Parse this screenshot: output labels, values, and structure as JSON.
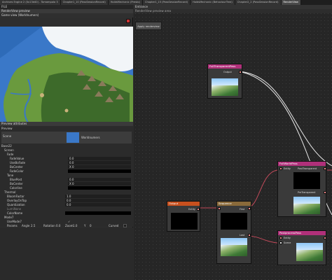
{
  "tabs": [
    {
      "label": "Archives Engine 2 (0x13d40) - Tomampola 3"
    },
    {
      "label": "Chapter1_10 (PassSessionRecord)"
    },
    {
      "label": "HoldsMechanic (Presto)"
    },
    {
      "label": "Chapter1_15 (PassSessionRecord)"
    },
    {
      "label": "HoldsMechanic (BehaviourTree)"
    },
    {
      "label": "Chapter2_2 (PassSessionRecord)"
    },
    {
      "label": "RenderView"
    }
  ],
  "menu": {
    "file": "FILE"
  },
  "left": {
    "preview_header": "RenderView preview",
    "preview_subheader": "Game view (Worldnumers)",
    "attr_header": "Preview attributes",
    "preview_section": "Preview",
    "scene_label": "Scene",
    "scene_value": "Worldnumers",
    "group_label": "Base22",
    "screen_label": "Screen",
    "fade_label": "Fade",
    "fade_value_label": "FadeValue",
    "fade_value": "0.0",
    "use_fade_label": "UseBoFade",
    "use_fade_value": "0.0",
    "bo_center_label": "BoCenter",
    "bo_center_value": "X   0",
    "fade_color_label": "FadeColor",
    "tone_label": "Tone",
    "blur_label": "BluePost",
    "blur_value": "0.0",
    "tone_center_label": "BoCenter",
    "tone_center_value": "X   0",
    "tone_color_label": "Colorline",
    "thermal_label": "Thermal",
    "bloom_label": "BloomFactor",
    "bloom_value": "1.0",
    "overlay_label": "OverlayOnTop",
    "overlay_value": "0.0",
    "quant_label": "Quantization",
    "quant_value": "0.0",
    "luminance_label": "LumiNone",
    "colorname_label": "ColorName",
    "mode_label": "Mode7",
    "usemode_label": "UseMode7",
    "params_label": "Params",
    "angle_label": "Angle",
    "angle_value": "2.5",
    "rotation_label": "Rotation",
    "rotation_value": "0.0",
    "zoom_label": "Zoom",
    "zoom_value": "1.0",
    "y_label": "Y",
    "y_value": "0",
    "curved_label": "Curved"
  },
  "right": {
    "header": "Entrance",
    "subheader": "RenderView preview area",
    "apply_button": "Apply renderview",
    "nodes": {
      "full_transparent": {
        "title": "FullTransparentPass",
        "port_out": "Output"
      },
      "full_world": {
        "title": "FullWorldPass",
        "port_entity": "Entity",
        "port_post": "PostTransparent",
        "port_pre": "PreTransparent"
      },
      "output": {
        "title": "Output",
        "port_entity": "Entity"
      },
      "sequence": {
        "title": "Sequence",
        "port_first": "First",
        "port_last": "Last"
      },
      "postprocess": {
        "title": "PostprocessPass",
        "port_entity": "Entity",
        "port_scene": "Scene"
      }
    }
  },
  "colors": {
    "node_title_pink": "#b0307a",
    "node_title_orange": "#c8501e",
    "node_title_tan": "#8a6a3a",
    "port_pink": "#e88aa0"
  }
}
